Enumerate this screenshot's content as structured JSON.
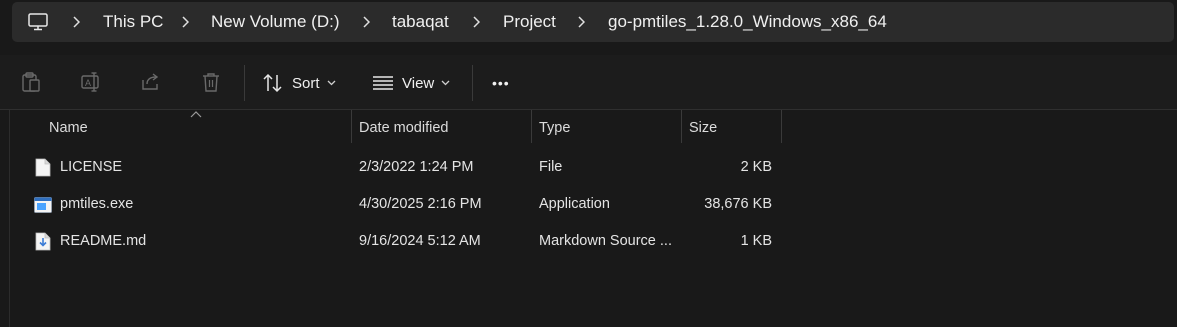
{
  "address_bar": {
    "breadcrumbs": [
      "This PC",
      "New Volume (D:)",
      "tabaqat",
      "Project",
      "go-pmtiles_1.28.0_Windows_x86_64"
    ],
    "root_icon": "computer-icon"
  },
  "toolbar": {
    "actions": [
      "paste-icon",
      "rename-icon",
      "share-icon",
      "delete-icon"
    ],
    "sort_label": "Sort",
    "view_label": "View",
    "more_label": "•••"
  },
  "columns": {
    "name": "Name",
    "date_modified": "Date modified",
    "type": "Type",
    "size": "Size"
  },
  "files": [
    {
      "name": "LICENSE",
      "date": "2/3/2022 1:24 PM",
      "type": "File",
      "size": "2 KB",
      "icon": "document-icon"
    },
    {
      "name": "pmtiles.exe",
      "date": "4/30/2025 2:16 PM",
      "type": "Application",
      "size": "38,676 KB",
      "icon": "application-icon"
    },
    {
      "name": "README.md",
      "date": "9/16/2024 5:12 AM",
      "type": "Markdown Source ...",
      "size": "1 KB",
      "icon": "markdown-file-icon"
    }
  ],
  "colors": {
    "background": "#191919",
    "address_bar": "#2b2b2b",
    "text": "#e6e6e6",
    "exe_accent": "#4aa3ff"
  }
}
